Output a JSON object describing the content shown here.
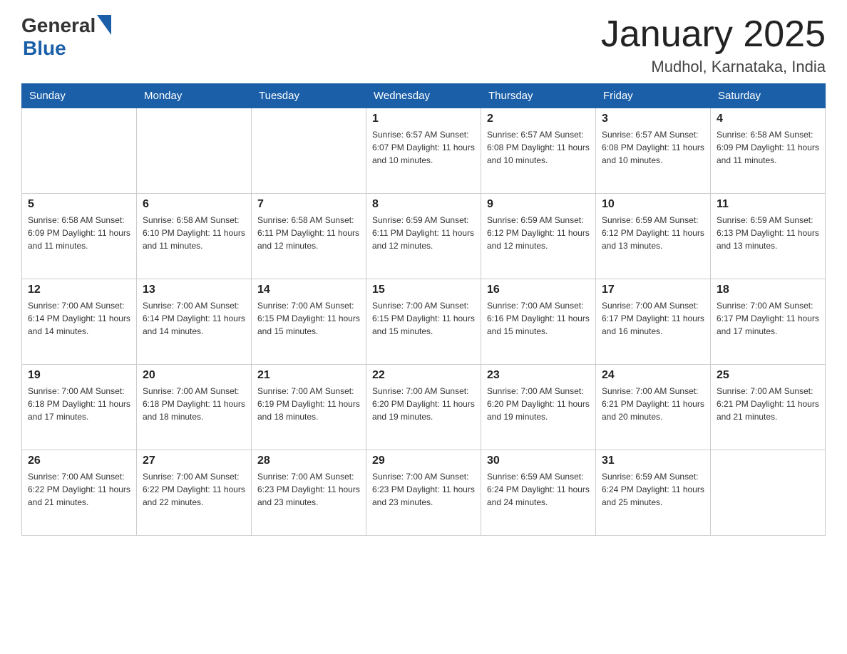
{
  "header": {
    "logo_general": "General",
    "logo_blue": "Blue",
    "month": "January 2025",
    "location": "Mudhol, Karnataka, India"
  },
  "days_of_week": [
    "Sunday",
    "Monday",
    "Tuesday",
    "Wednesday",
    "Thursday",
    "Friday",
    "Saturday"
  ],
  "weeks": [
    [
      {
        "day": "",
        "info": ""
      },
      {
        "day": "",
        "info": ""
      },
      {
        "day": "",
        "info": ""
      },
      {
        "day": "1",
        "info": "Sunrise: 6:57 AM\nSunset: 6:07 PM\nDaylight: 11 hours\nand 10 minutes."
      },
      {
        "day": "2",
        "info": "Sunrise: 6:57 AM\nSunset: 6:08 PM\nDaylight: 11 hours\nand 10 minutes."
      },
      {
        "day": "3",
        "info": "Sunrise: 6:57 AM\nSunset: 6:08 PM\nDaylight: 11 hours\nand 10 minutes."
      },
      {
        "day": "4",
        "info": "Sunrise: 6:58 AM\nSunset: 6:09 PM\nDaylight: 11 hours\nand 11 minutes."
      }
    ],
    [
      {
        "day": "5",
        "info": "Sunrise: 6:58 AM\nSunset: 6:09 PM\nDaylight: 11 hours\nand 11 minutes."
      },
      {
        "day": "6",
        "info": "Sunrise: 6:58 AM\nSunset: 6:10 PM\nDaylight: 11 hours\nand 11 minutes."
      },
      {
        "day": "7",
        "info": "Sunrise: 6:58 AM\nSunset: 6:11 PM\nDaylight: 11 hours\nand 12 minutes."
      },
      {
        "day": "8",
        "info": "Sunrise: 6:59 AM\nSunset: 6:11 PM\nDaylight: 11 hours\nand 12 minutes."
      },
      {
        "day": "9",
        "info": "Sunrise: 6:59 AM\nSunset: 6:12 PM\nDaylight: 11 hours\nand 12 minutes."
      },
      {
        "day": "10",
        "info": "Sunrise: 6:59 AM\nSunset: 6:12 PM\nDaylight: 11 hours\nand 13 minutes."
      },
      {
        "day": "11",
        "info": "Sunrise: 6:59 AM\nSunset: 6:13 PM\nDaylight: 11 hours\nand 13 minutes."
      }
    ],
    [
      {
        "day": "12",
        "info": "Sunrise: 7:00 AM\nSunset: 6:14 PM\nDaylight: 11 hours\nand 14 minutes."
      },
      {
        "day": "13",
        "info": "Sunrise: 7:00 AM\nSunset: 6:14 PM\nDaylight: 11 hours\nand 14 minutes."
      },
      {
        "day": "14",
        "info": "Sunrise: 7:00 AM\nSunset: 6:15 PM\nDaylight: 11 hours\nand 15 minutes."
      },
      {
        "day": "15",
        "info": "Sunrise: 7:00 AM\nSunset: 6:15 PM\nDaylight: 11 hours\nand 15 minutes."
      },
      {
        "day": "16",
        "info": "Sunrise: 7:00 AM\nSunset: 6:16 PM\nDaylight: 11 hours\nand 15 minutes."
      },
      {
        "day": "17",
        "info": "Sunrise: 7:00 AM\nSunset: 6:17 PM\nDaylight: 11 hours\nand 16 minutes."
      },
      {
        "day": "18",
        "info": "Sunrise: 7:00 AM\nSunset: 6:17 PM\nDaylight: 11 hours\nand 17 minutes."
      }
    ],
    [
      {
        "day": "19",
        "info": "Sunrise: 7:00 AM\nSunset: 6:18 PM\nDaylight: 11 hours\nand 17 minutes."
      },
      {
        "day": "20",
        "info": "Sunrise: 7:00 AM\nSunset: 6:18 PM\nDaylight: 11 hours\nand 18 minutes."
      },
      {
        "day": "21",
        "info": "Sunrise: 7:00 AM\nSunset: 6:19 PM\nDaylight: 11 hours\nand 18 minutes."
      },
      {
        "day": "22",
        "info": "Sunrise: 7:00 AM\nSunset: 6:20 PM\nDaylight: 11 hours\nand 19 minutes."
      },
      {
        "day": "23",
        "info": "Sunrise: 7:00 AM\nSunset: 6:20 PM\nDaylight: 11 hours\nand 19 minutes."
      },
      {
        "day": "24",
        "info": "Sunrise: 7:00 AM\nSunset: 6:21 PM\nDaylight: 11 hours\nand 20 minutes."
      },
      {
        "day": "25",
        "info": "Sunrise: 7:00 AM\nSunset: 6:21 PM\nDaylight: 11 hours\nand 21 minutes."
      }
    ],
    [
      {
        "day": "26",
        "info": "Sunrise: 7:00 AM\nSunset: 6:22 PM\nDaylight: 11 hours\nand 21 minutes."
      },
      {
        "day": "27",
        "info": "Sunrise: 7:00 AM\nSunset: 6:22 PM\nDaylight: 11 hours\nand 22 minutes."
      },
      {
        "day": "28",
        "info": "Sunrise: 7:00 AM\nSunset: 6:23 PM\nDaylight: 11 hours\nand 23 minutes."
      },
      {
        "day": "29",
        "info": "Sunrise: 7:00 AM\nSunset: 6:23 PM\nDaylight: 11 hours\nand 23 minutes."
      },
      {
        "day": "30",
        "info": "Sunrise: 6:59 AM\nSunset: 6:24 PM\nDaylight: 11 hours\nand 24 minutes."
      },
      {
        "day": "31",
        "info": "Sunrise: 6:59 AM\nSunset: 6:24 PM\nDaylight: 11 hours\nand 25 minutes."
      },
      {
        "day": "",
        "info": ""
      }
    ]
  ]
}
